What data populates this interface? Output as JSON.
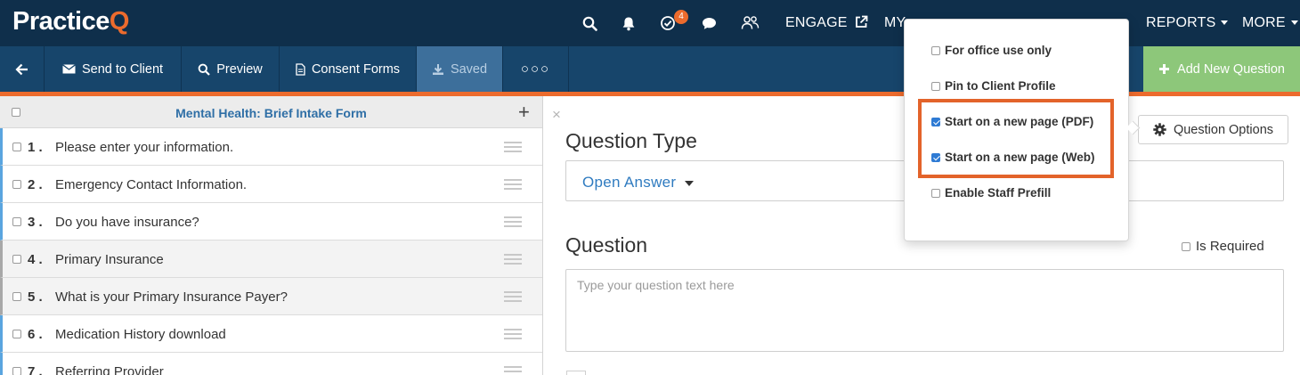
{
  "brand": {
    "logo_main": "Practice",
    "logo_q": "Q",
    "accent": "#ec6b2d",
    "nav_bg": "#0f2f4b",
    "toolbar_bg": "#17456b",
    "add_bg": "#8dc77a"
  },
  "topnav": {
    "icons": [
      "search-icon",
      "bell-icon",
      "tasks-check-icon",
      "chat-icon",
      "users-icon"
    ],
    "tasks_badge": "4",
    "engage_label": "ENGAGE",
    "my_label": "MY",
    "reports_label": "REPORTS",
    "more_label": "MORE"
  },
  "toolbar": {
    "back_icon": "arrow-left-icon",
    "send_label": "Send to Client",
    "preview_label": "Preview",
    "consent_label": "Consent Forms",
    "saved_label": "Saved",
    "more_label": "○○○",
    "add_question_label": "Add New Question"
  },
  "form": {
    "title": "Mental Health: Brief Intake Form",
    "add_symbol": "+",
    "questions": [
      {
        "num": "1 .",
        "text": "Please enter your information.",
        "alt": false
      },
      {
        "num": "2 .",
        "text": "Emergency Contact Information.",
        "alt": false
      },
      {
        "num": "3 .",
        "text": "Do you have insurance?",
        "alt": false
      },
      {
        "num": "4 .",
        "text": "Primary Insurance",
        "alt": true
      },
      {
        "num": "5 .",
        "text": "What is your Primary Insurance Payer?",
        "alt": true
      },
      {
        "num": "6 .",
        "text": "Medication History download",
        "alt": false
      },
      {
        "num": "7 .",
        "text": "Referring Provider",
        "alt": false
      }
    ]
  },
  "editor": {
    "close_symbol": "×",
    "question_type_label": "Question Type",
    "question_type_value": "Open Answer",
    "question_label": "Question",
    "is_required_label": "Is Required",
    "question_placeholder": "Type your question text here",
    "question_options_label": "Question Options"
  },
  "options_menu": {
    "items": [
      {
        "label": "For office use only",
        "checked": false
      },
      {
        "label": "Pin to Client Profile",
        "checked": false
      },
      {
        "label": "Start on a new page (PDF)",
        "checked": true
      },
      {
        "label": "Start on a new page (Web)",
        "checked": true
      },
      {
        "label": "Enable Staff Prefill",
        "checked": false
      }
    ],
    "highlight_color": "#e3632a"
  }
}
